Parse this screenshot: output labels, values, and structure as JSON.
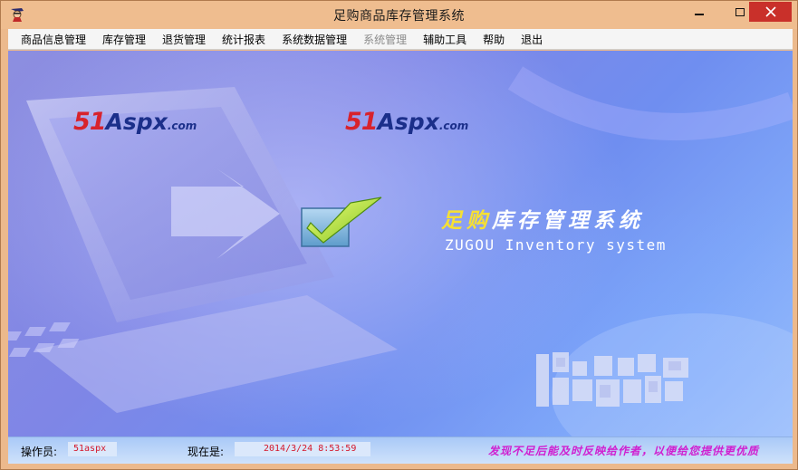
{
  "window": {
    "title": "足购商品库存管理系统"
  },
  "menu": {
    "items": [
      {
        "label": "商品信息管理",
        "enabled": true
      },
      {
        "label": "库存管理",
        "enabled": true
      },
      {
        "label": "退货管理",
        "enabled": true
      },
      {
        "label": "统计报表",
        "enabled": true
      },
      {
        "label": "系统数据管理",
        "enabled": true
      },
      {
        "label": "系统管理",
        "enabled": false
      },
      {
        "label": "辅助工具",
        "enabled": true
      },
      {
        "label": "帮助",
        "enabled": true
      },
      {
        "label": "退出",
        "enabled": true
      }
    ]
  },
  "splash": {
    "logo_num": "51",
    "logo_aspx": "Aspx",
    "logo_com": ".com",
    "title_highlight": "足购",
    "title_rest": "库存管理系统",
    "english_title": "ZUGOU Inventory system"
  },
  "status": {
    "operator_label": "操作员:",
    "operator_value": "51aspx",
    "now_label": "现在是:",
    "now_value": "2014/3/24 8:53:59",
    "scroll_text": "发现不足后能及时反映给作者，以便给您提供更优质"
  },
  "colors": {
    "titlebar": "#efbd8f",
    "close_button": "#c9302a",
    "status_value_text": "#d4172a",
    "scroll_text": "#d01fd0",
    "title_highlight": "#f6e033"
  },
  "icons": [
    "app-icon",
    "minimize-icon",
    "maximize-icon",
    "close-icon",
    "checkmark-icon"
  ]
}
